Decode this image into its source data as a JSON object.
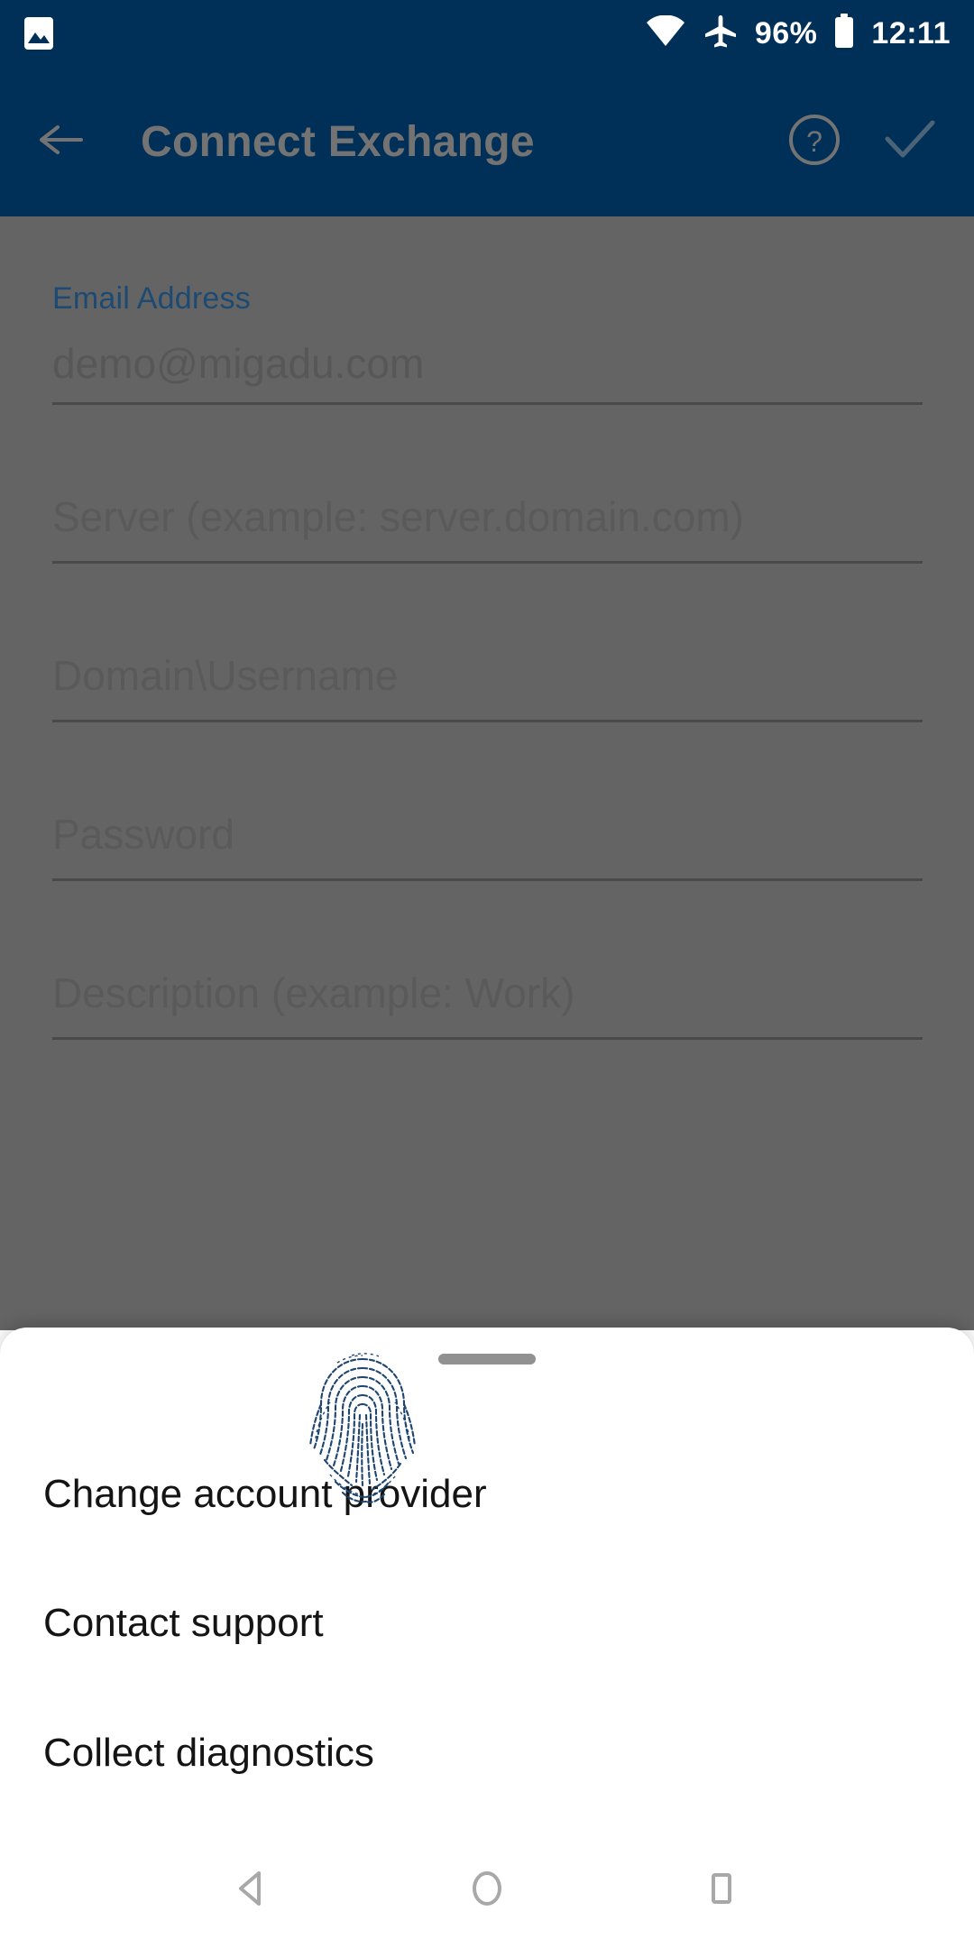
{
  "status_bar": {
    "background": "#003057",
    "left_icons": [
      {
        "name": "photo-icon",
        "glyph": "image"
      }
    ],
    "wifi_icon": "wifi-icon",
    "airplane_icon": "airplane-mode-icon",
    "battery_percent": "96%",
    "battery_icon": "battery-icon",
    "time": "12:11"
  },
  "app_bar": {
    "background": "#003057",
    "back_icon": "back-arrow-icon",
    "title": "Connect Exchange",
    "title_color": "#737373",
    "help_icon": "help-circle-icon",
    "done_icon": "checkmark-icon"
  },
  "form": {
    "scrim_color": "#646464",
    "fields": [
      {
        "key": "email",
        "label": "Email Address",
        "label_color": "#1d4a73",
        "value": "demo@migadu.com",
        "placeholder": "Email Address",
        "has_label": true
      },
      {
        "key": "server",
        "label": "",
        "value": "",
        "placeholder": "Server (example: server.domain.com)",
        "has_label": false
      },
      {
        "key": "domain_username",
        "label": "",
        "value": "",
        "placeholder": "Domain\\Username",
        "has_label": false
      },
      {
        "key": "password",
        "label": "",
        "value": "",
        "placeholder": "Password",
        "has_label": false
      },
      {
        "key": "description",
        "label": "",
        "value": "",
        "placeholder": "Description (example: Work)",
        "has_label": false
      }
    ]
  },
  "bottom_sheet": {
    "background": "#ffffff",
    "handle_color": "#919191",
    "fingerprint_color": "#1e4470",
    "fingerprint_icon": "fingerprint-graphic",
    "items": [
      {
        "label": "Change account provider"
      },
      {
        "label": "Contact support"
      },
      {
        "label": "Collect diagnostics"
      }
    ]
  },
  "nav_bar": {
    "background": "#ffffff",
    "icon_color": "#a8a8a8",
    "back": "nav-back-icon",
    "home": "nav-home-icon",
    "recents": "nav-recents-icon"
  }
}
